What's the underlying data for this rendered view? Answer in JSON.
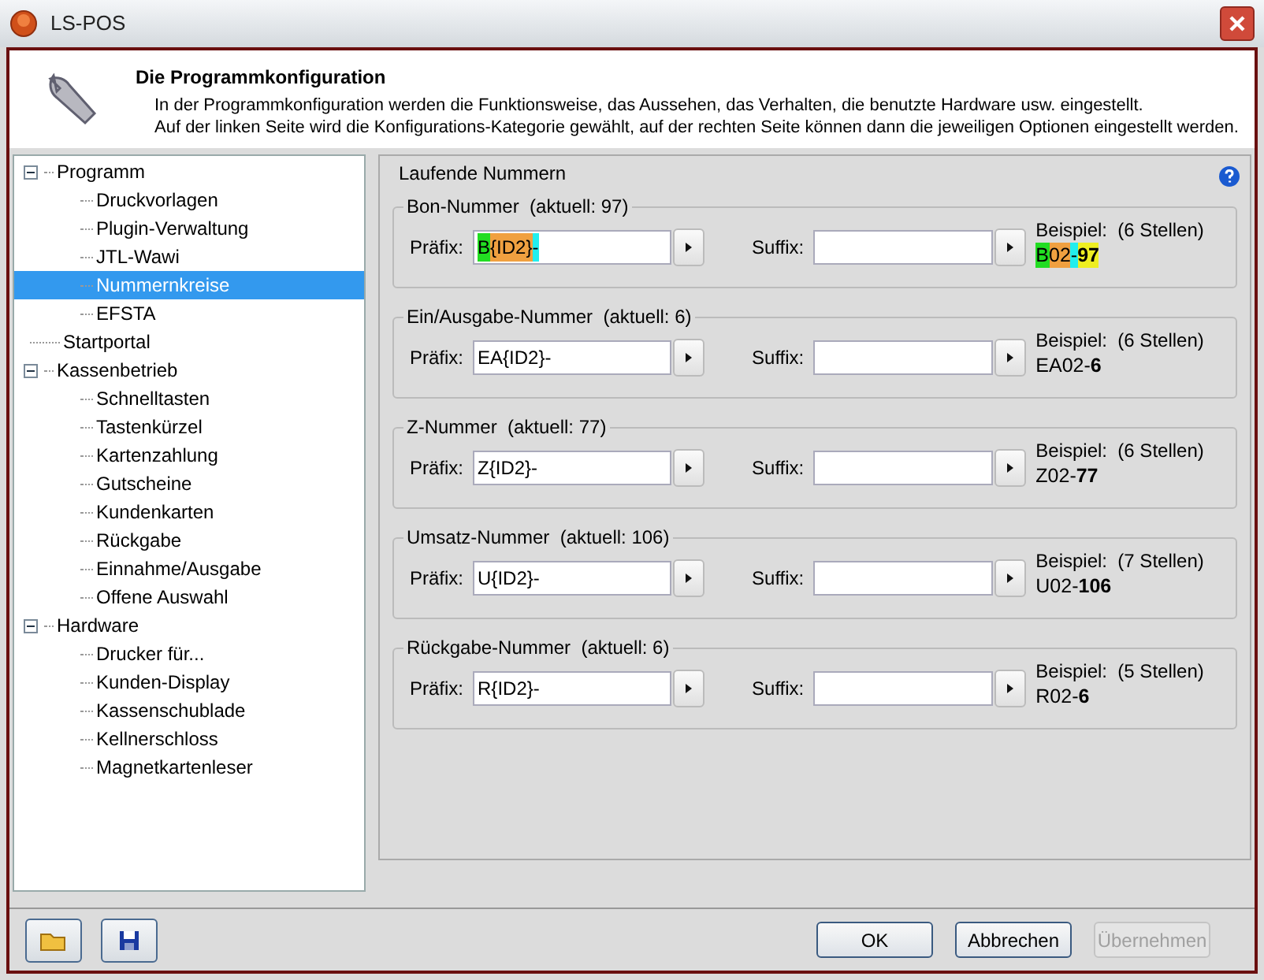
{
  "window": {
    "title": "LS-POS"
  },
  "header": {
    "title": "Die Programmkonfiguration",
    "lines": [
      "In der Programmkonfiguration werden die Funktionsweise, das Aussehen, das Verhalten, die benutzte Hardware usw. eingestellt.",
      "Auf der linken Seite wird die Konfigurations-Kategorie gewählt, auf der rechten Seite können dann die jeweiligen Optionen eingestellt werden."
    ]
  },
  "tree": [
    {
      "label": "Programm",
      "expanded": true,
      "selected": false,
      "children": [
        {
          "label": "Druckvorlagen",
          "selected": false
        },
        {
          "label": "Plugin-Verwaltung",
          "selected": false
        },
        {
          "label": "JTL-Wawi",
          "selected": false
        },
        {
          "label": "Nummernkreise",
          "selected": true
        },
        {
          "label": "EFSTA",
          "selected": false
        }
      ]
    },
    {
      "label": "Startportal",
      "selected": false
    },
    {
      "label": "Kassenbetrieb",
      "expanded": true,
      "selected": false,
      "children": [
        {
          "label": "Schnelltasten",
          "selected": false
        },
        {
          "label": "Tastenkürzel",
          "selected": false
        },
        {
          "label": "Kartenzahlung",
          "selected": false
        },
        {
          "label": "Gutscheine",
          "selected": false
        },
        {
          "label": "Kundenkarten",
          "selected": false
        },
        {
          "label": "Rückgabe",
          "selected": false
        },
        {
          "label": "Einnahme/Ausgabe",
          "selected": false
        },
        {
          "label": "Offene Auswahl",
          "selected": false
        }
      ]
    },
    {
      "label": "Hardware",
      "expanded": true,
      "selected": false,
      "children": [
        {
          "label": "Drucker für...",
          "selected": false
        },
        {
          "label": "Kunden-Display",
          "selected": false
        },
        {
          "label": "Kassenschublade",
          "selected": false
        },
        {
          "label": "Kellnerschloss",
          "selected": false
        },
        {
          "label": "Magnetkartenleser",
          "selected": false
        }
      ]
    }
  ],
  "panel": {
    "title": "Laufende Nummern",
    "groups": [
      {
        "title": "Bon-Nummer  (aktuell: 97)",
        "prefix_label": "Präfix:",
        "prefix": [
          {
            "text": "B",
            "color": "#22dd22"
          },
          {
            "text": "{ID2}",
            "color": "#f0a040"
          },
          {
            "text": "-",
            "color": "#22eeee"
          }
        ],
        "suffix_label": "Suffix:",
        "example_label": "Beispiel:  (6 Stellen)",
        "example": [
          {
            "text": "B",
            "color": "#22dd22",
            "bold": false
          },
          {
            "text": "02",
            "color": "#f0a040",
            "bold": false
          },
          {
            "text": "-",
            "color": "#22eeee",
            "bold": false
          },
          {
            "text": "97",
            "color": "#eeee22",
            "bold": true
          }
        ]
      },
      {
        "title": "Ein/Ausgabe-Nummer  (aktuell: 6)",
        "prefix_label": "Präfix:",
        "prefix": [
          {
            "text": "EA{ID2}-"
          }
        ],
        "suffix_label": "Suffix:",
        "example_label": "Beispiel:  (6 Stellen)",
        "example": [
          {
            "text": "EA02-",
            "bold": false
          },
          {
            "text": "6",
            "bold": true
          }
        ]
      },
      {
        "title": "Z-Nummer  (aktuell: 77)",
        "prefix_label": "Präfix:",
        "prefix": [
          {
            "text": "Z{ID2}-"
          }
        ],
        "suffix_label": "Suffix:",
        "example_label": "Beispiel:  (6 Stellen)",
        "example": [
          {
            "text": "Z02-",
            "bold": false
          },
          {
            "text": "77",
            "bold": true
          }
        ]
      },
      {
        "title": "Umsatz-Nummer  (aktuell: 106)",
        "prefix_label": "Präfix:",
        "prefix": [
          {
            "text": "U{ID2}-"
          }
        ],
        "suffix_label": "Suffix:",
        "example_label": "Beispiel:  (7 Stellen)",
        "example": [
          {
            "text": "U02-",
            "bold": false
          },
          {
            "text": "106",
            "bold": true
          }
        ]
      },
      {
        "title": "Rückgabe-Nummer  (aktuell: 6)",
        "prefix_label": "Präfix:",
        "prefix": [
          {
            "text": "R{ID2}-"
          }
        ],
        "suffix_label": "Suffix:",
        "example_label": "Beispiel:  (5 Stellen)",
        "example": [
          {
            "text": "R02-",
            "bold": false
          },
          {
            "text": "6",
            "bold": true
          }
        ]
      }
    ]
  },
  "buttons": [
    {
      "label": "OK",
      "disabled": false
    },
    {
      "label": "Abbrechen",
      "disabled": false
    },
    {
      "label": "Übernehmen",
      "disabled": true
    }
  ]
}
